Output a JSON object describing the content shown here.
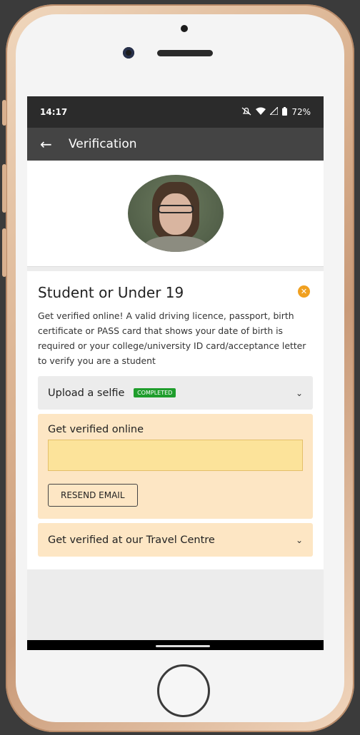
{
  "status": {
    "time": "14:17",
    "battery": "72%"
  },
  "appbar": {
    "title": "Verification"
  },
  "card": {
    "title": "Student or Under 19",
    "description": "Get verified online! A valid driving licence, passport, birth certificate or PASS card that shows your date of birth is required or your college/university ID card/acceptance letter to verify you are a student"
  },
  "steps": [
    {
      "label": "Upload a selfie",
      "badge": "COMPLETED"
    },
    {
      "label": "Get verified online",
      "button": "RESEND EMAIL"
    },
    {
      "label": "Get verified at our Travel Centre"
    }
  ],
  "colors": {
    "accent": "#f0a020",
    "completed": "#1f9d2c",
    "step_bg": "#fde6c4"
  }
}
